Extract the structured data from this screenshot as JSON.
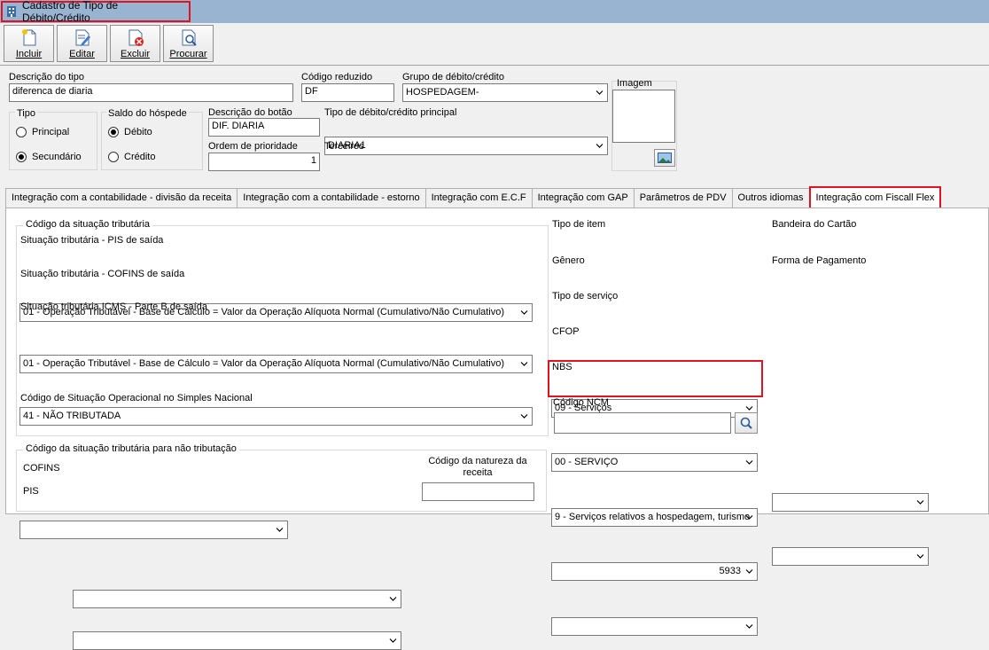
{
  "window": {
    "title": "Cadastro de Tipo de Débito/Crédito"
  },
  "toolbar": {
    "incluir": "Incluir",
    "editar": "Editar",
    "excluir": "Excluir",
    "procurar": "Procurar"
  },
  "form": {
    "descricao_tipo": {
      "label": "Descrição do tipo",
      "value": "diferenca de diaria"
    },
    "codigo_reduzido": {
      "label": "Código reduzido",
      "value": "DF"
    },
    "grupo": {
      "label": "Grupo de débito/crédito",
      "value": "HOSPEDAGEM-"
    },
    "imagem": {
      "label": "Imagem"
    },
    "tipo": {
      "label": "Tipo",
      "principal": "Principal",
      "secundario": "Secundário",
      "selected": "Secundário"
    },
    "saldo": {
      "label": "Saldo do hóspede",
      "debito": "Débito",
      "credito": "Crédito",
      "selected": "Débito"
    },
    "descricao_botao": {
      "label": "Descrição do botão",
      "value": "DIF. DIARIA"
    },
    "tipo_principal": {
      "label": "Tipo de débito/crédito principal",
      "value": "DIARIA1"
    },
    "ordem": {
      "label": "Ordem de prioridade",
      "value": "1"
    },
    "terceiros": {
      "label": "Terceiros",
      "value": ""
    }
  },
  "tabs": [
    "Integração com a contabilidade - divisão da receita",
    "Integração com a contabilidade - estorno",
    "Integração com E.C.F",
    "Integração com GAP",
    "Parâmetros de PDV",
    "Outros idiomas",
    "Integração com Fiscall Flex"
  ],
  "fiscal": {
    "grupo_situacao": "Código da situação tributária",
    "pis": {
      "label": "Situação tributária - PIS de saída",
      "value": "01 - Operação Tributável - Base de Cálculo = Valor da Operação Alíquota Normal (Cumulativo/Não Cumulativo)"
    },
    "cofins": {
      "label": "Situação tributária - COFINS de saída",
      "value": "01 - Operação Tributável - Base de Cálculo = Valor da Operação Alíquota Normal (Cumulativo/Não Cumulativo)"
    },
    "icms": {
      "label": "Situação tributária ICMS -  Parte B de saída",
      "value": "41 - NÃO TRIBUTADA"
    },
    "simples": {
      "label": "Código de Situação Operacional no Simples Nacional",
      "value": ""
    },
    "grupo_nao_trib": "Código da situação tributária para não tributação",
    "cofins_nt": {
      "label": "COFINS",
      "value": ""
    },
    "pis_nt": {
      "label": "PIS",
      "value": ""
    },
    "natureza": {
      "label": "Código da natureza da receita",
      "value": ""
    },
    "tipo_item": {
      "label": "Tipo de item",
      "value": "09 - Serviços"
    },
    "genero": {
      "label": "Gênero",
      "value": "00 - SERVIÇO"
    },
    "tipo_servico": {
      "label": "Tipo de serviço",
      "value": "9 - Serviços relativos a hospedagem, turismo"
    },
    "cfop": {
      "label": "CFOP",
      "value": "5933"
    },
    "nbs": {
      "label": "NBS",
      "value": ""
    },
    "ncm": {
      "label": "Código NCM",
      "value": ""
    },
    "bandeira": {
      "label": "Bandeira do Cartão",
      "value": ""
    },
    "forma_pagamento": {
      "label": "Forma de Pagamento",
      "value": ""
    }
  },
  "colors": {
    "titlebar": "#99b4d1",
    "highlight": "#e0141e"
  }
}
